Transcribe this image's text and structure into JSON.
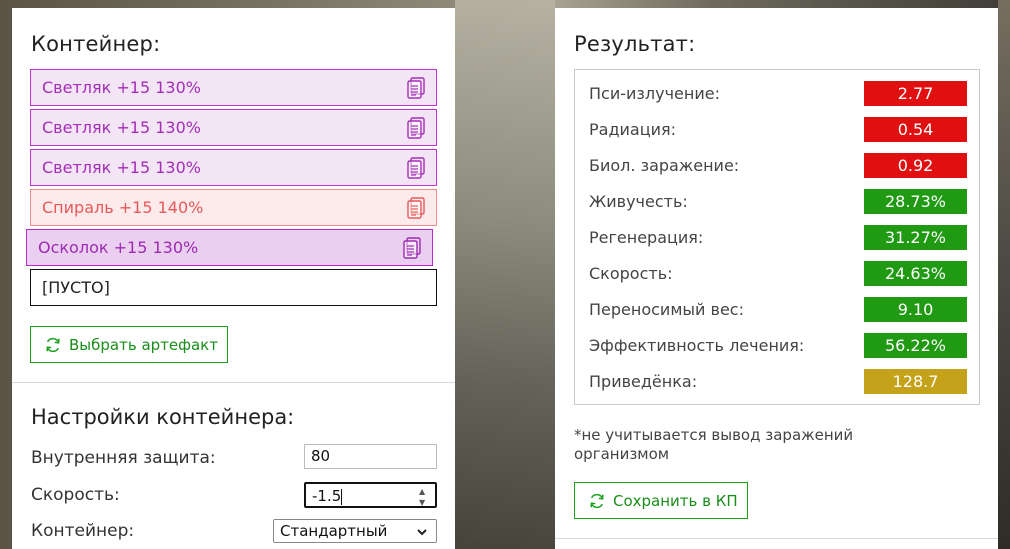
{
  "container": {
    "title": "Контейнер:",
    "slots": [
      {
        "label": "Светляк +15 130%",
        "style": "purple"
      },
      {
        "label": "Светляк +15 130%",
        "style": "purple"
      },
      {
        "label": "Светляк +15 130%",
        "style": "purple"
      },
      {
        "label": "Спираль +15 140%",
        "style": "red"
      },
      {
        "label": "Осколок +15 130%",
        "style": "dark-purple"
      },
      {
        "label": "[ПУСТО]",
        "style": "empty"
      }
    ],
    "choose_button": "Выбрать артефакт"
  },
  "settings": {
    "title": "Настройки контейнера:",
    "inner_protection_label": "Внутренняя защита:",
    "inner_protection_value": "80",
    "speed_label": "Скорость:",
    "speed_value": "-1.5",
    "container_label": "Контейнер:",
    "container_value": "Стандартный"
  },
  "result": {
    "title": "Результат:",
    "rows": [
      {
        "label": "Пси-излучение:",
        "value": "2.77",
        "status": "bad"
      },
      {
        "label": "Радиация:",
        "value": "0.54",
        "status": "bad"
      },
      {
        "label": "Биол. заражение:",
        "value": "0.92",
        "status": "bad"
      },
      {
        "label": "Живучесть:",
        "value": "28.73%",
        "status": "good"
      },
      {
        "label": "Регенерация:",
        "value": "31.27%",
        "status": "good"
      },
      {
        "label": "Скорость:",
        "value": "24.63%",
        "status": "good"
      },
      {
        "label": "Переносимый вес:",
        "value": "9.10",
        "status": "good"
      },
      {
        "label": "Эффективность лечения:",
        "value": "56.22%",
        "status": "good"
      },
      {
        "label": "Приведёнка:",
        "value": "128.7",
        "status": "neutral"
      }
    ],
    "note": "*не учитывается вывод заражений организмом",
    "save_button": "Сохранить в КП"
  },
  "colors": {
    "bad": "#e01010",
    "good": "#1f9a12",
    "neutral": "#c4a21a",
    "accent_green": "#1aa01a"
  },
  "icons": {
    "slot_icon": "document-copy-icon",
    "button_icon": "refresh-icon",
    "select_icon": "chevron-down-icon",
    "spinner_icon": "spinner-arrows-icon"
  }
}
